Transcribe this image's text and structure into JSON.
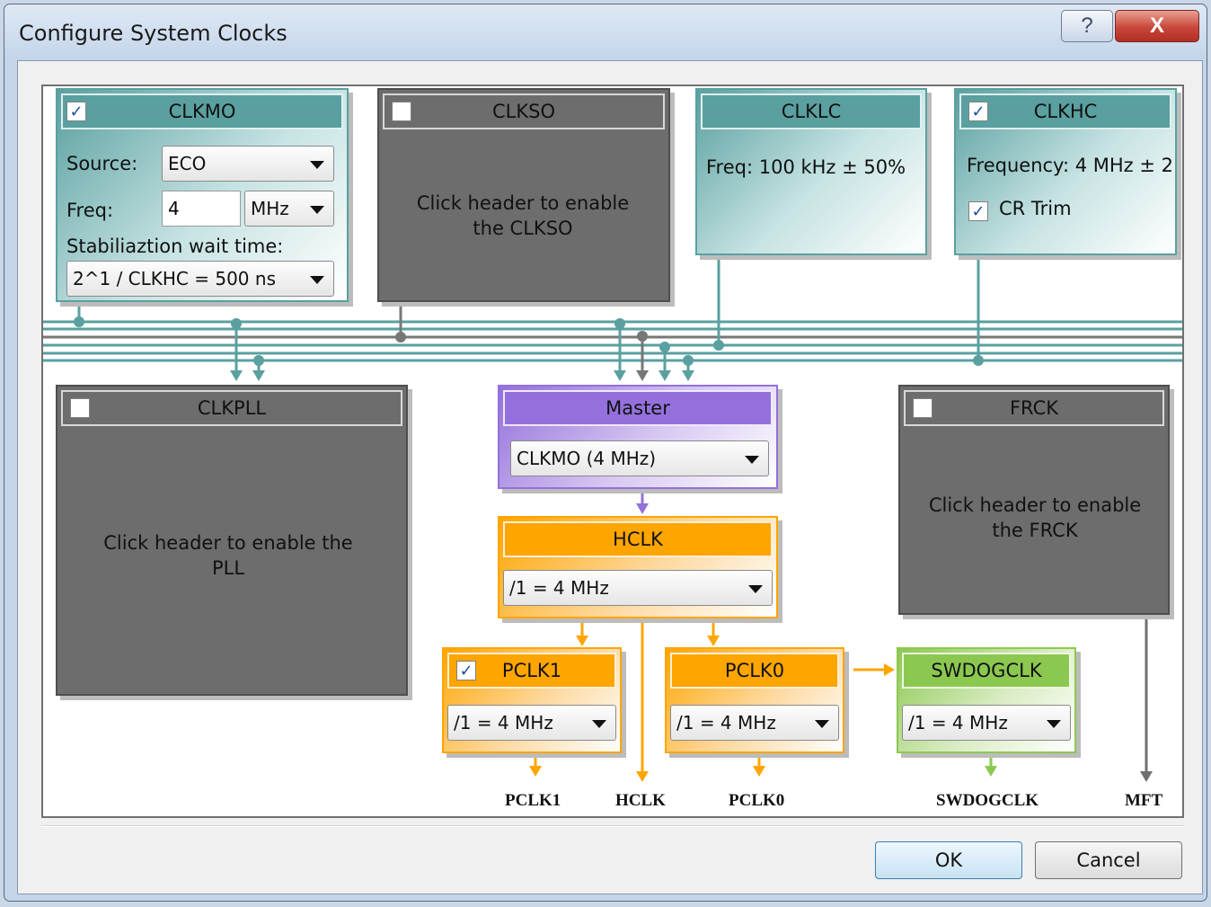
{
  "window": {
    "title": "Configure System Clocks",
    "help_glyph": "?",
    "close_glyph": "X"
  },
  "buttons": {
    "ok": "OK",
    "cancel": "Cancel"
  },
  "colors": {
    "teal": "#5aa0a0",
    "gray": "#6d6d6d",
    "purple": "#9370db",
    "orange": "#ffa500",
    "green": "#8cc850"
  },
  "clkmo": {
    "title": "CLKMO",
    "enabled": true,
    "check_glyph": "✓",
    "source_label": "Source:",
    "source_value": "ECO",
    "freq_label": "Freq:",
    "freq_value": "4",
    "freq_unit": "MHz",
    "wait_label": "Stabiliaztion wait time:",
    "wait_value": "2^1 / CLKHC = 500 ns"
  },
  "clkso": {
    "title": "CLKSO",
    "enabled": false,
    "message": "Click header to enable the CLKSO"
  },
  "clklc": {
    "title": "CLKLC",
    "freq_text": "Freq: 100 kHz ± 50%"
  },
  "clkhc": {
    "title": "CLKHC",
    "enabled": true,
    "check_glyph": "✓",
    "freq_text": "Frequency: 4 MHz ± 2",
    "crtrim_label": "CR Trim",
    "crtrim_checked": true
  },
  "clkpll": {
    "title": "CLKPLL",
    "enabled": false,
    "message": "Click header to enable the PLL"
  },
  "master": {
    "title": "Master",
    "value": "CLKMO (4 MHz)"
  },
  "frck": {
    "title": "FRCK",
    "enabled": false,
    "message": "Click header to enable the FRCK"
  },
  "hclk": {
    "title": "HCLK",
    "value": "/1 = 4 MHz"
  },
  "pclk1": {
    "title": "PCLK1",
    "enabled": true,
    "check_glyph": "✓",
    "value": "/1 = 4 MHz"
  },
  "pclk0": {
    "title": "PCLK0",
    "value": "/1 = 4 MHz"
  },
  "swdogclk": {
    "title": "SWDOGCLK",
    "value": "/1 = 4 MHz"
  },
  "outputs": {
    "pclk1": "PCLK1",
    "hclk": "HCLK",
    "pclk0": "PCLK0",
    "swdogclk": "SWDOGCLK",
    "mft": "MFT"
  }
}
